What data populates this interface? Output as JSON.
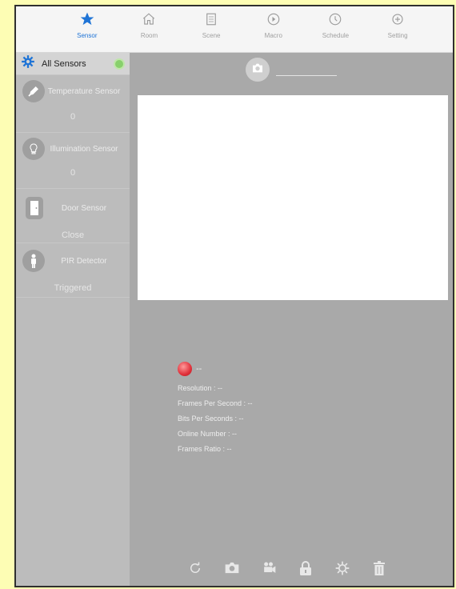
{
  "tabs": [
    {
      "label": "Sensor",
      "icon": "star-icon",
      "active": true
    },
    {
      "label": "Room",
      "icon": "home-icon",
      "active": false
    },
    {
      "label": "Scene",
      "icon": "scene-icon",
      "active": false
    },
    {
      "label": "Macro",
      "icon": "macro-icon",
      "active": false
    },
    {
      "label": "Schedule",
      "icon": "clock-icon",
      "active": false
    },
    {
      "label": "Setting",
      "icon": "setting-icon",
      "active": false
    }
  ],
  "sidebar": {
    "all_sensors_label": "All Sensors",
    "items": [
      {
        "name": "Temperature Sensor",
        "value": "0",
        "icon": "thermometer-icon"
      },
      {
        "name": "Illumination Sensor",
        "value": "0",
        "icon": "lightbulb-icon"
      },
      {
        "name": "Door Sensor",
        "value": "Close",
        "icon": "door-icon"
      },
      {
        "name": "PIR Detector",
        "value": "Triggered",
        "icon": "person-icon"
      }
    ]
  },
  "camera": {
    "status": "--",
    "resolution": "Resolution : --",
    "fps": "Frames Per Second : --",
    "bps": "Bits Per Seconds : --",
    "online": "Online Number : --",
    "ratio": "Frames Ratio : --"
  },
  "colors": {
    "accent": "#1f74d6",
    "online": "#88d06c",
    "record": "#e0303a"
  }
}
